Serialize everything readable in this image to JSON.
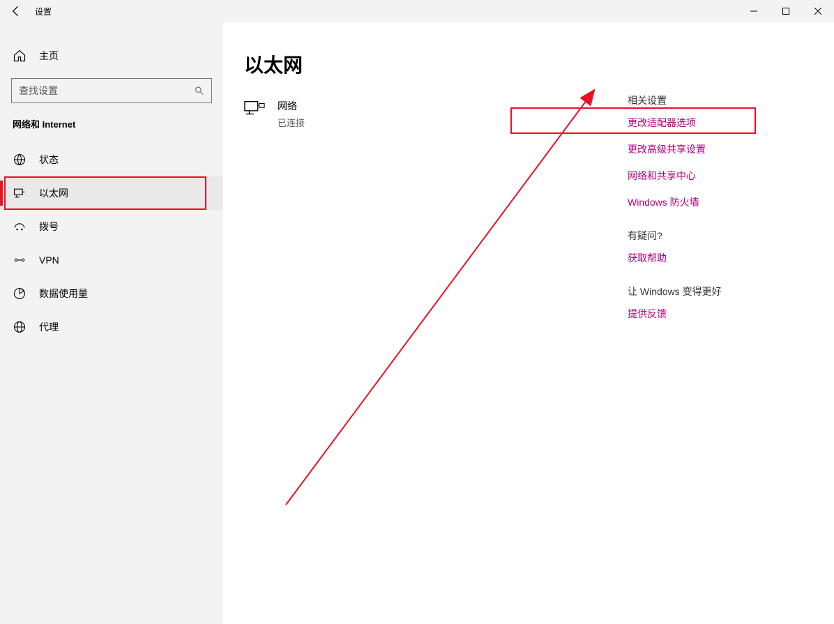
{
  "titlebar": {
    "title": "设置"
  },
  "sidebar": {
    "home_label": "主页",
    "search_placeholder": "查找设置",
    "section_label": "网络和 Internet",
    "items": [
      {
        "label": "状态"
      },
      {
        "label": "以太网"
      },
      {
        "label": "拨号"
      },
      {
        "label": "VPN"
      },
      {
        "label": "数据使用量"
      },
      {
        "label": "代理"
      }
    ]
  },
  "main": {
    "heading": "以太网",
    "network": {
      "name": "网络",
      "status": "已连接"
    }
  },
  "right": {
    "related_heading": "相关设置",
    "links": [
      "更改适配器选项",
      "更改高级共享设置",
      "网络和共享中心",
      "Windows 防火墙"
    ],
    "question_heading": "有疑问?",
    "help_link": "获取帮助",
    "feedback_heading": "让 Windows 变得更好",
    "feedback_link": "提供反馈"
  }
}
